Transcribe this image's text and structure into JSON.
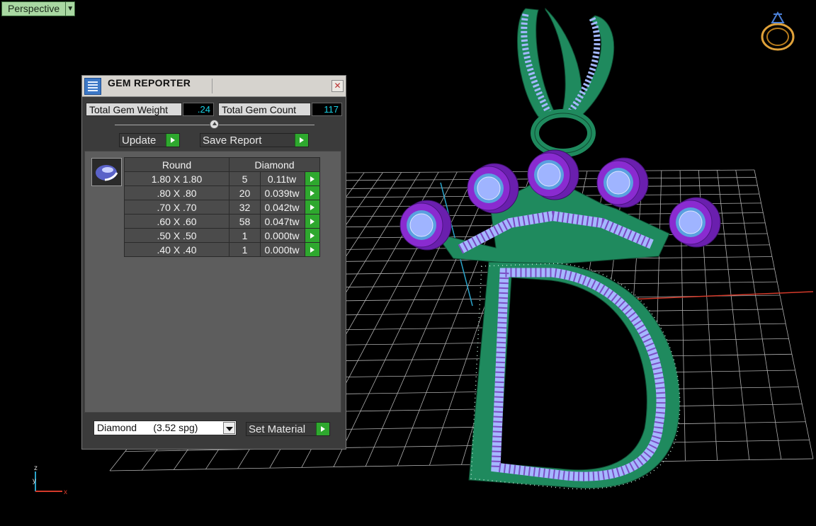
{
  "viewport": {
    "label": "Perspective"
  },
  "gem_reporter": {
    "title": "GEM REPORTER",
    "total_weight_label": "Total Gem Weight",
    "total_weight_value": ".24",
    "total_count_label": "Total Gem Count",
    "total_count_value": "117",
    "update_label": "Update",
    "save_report_label": "Save Report",
    "table": {
      "cut": "Round",
      "material": "Diamond",
      "rows": [
        {
          "size": "1.80 X 1.80",
          "count": "5",
          "weight": "0.11tw"
        },
        {
          "size": ".80 X .80",
          "count": "20",
          "weight": "0.039tw"
        },
        {
          "size": ".70 X .70",
          "count": "32",
          "weight": "0.042tw"
        },
        {
          "size": ".60 X .60",
          "count": "58",
          "weight": "0.047tw"
        },
        {
          "size": ".50 X .50",
          "count": "1",
          "weight": "0.000tw"
        },
        {
          "size": ".40 X .40",
          "count": "1",
          "weight": "0.000tw"
        }
      ]
    },
    "material_select": "Diamond      (3.52 spg)",
    "set_material_label": "Set Material"
  },
  "axes": {
    "z": "z",
    "y": "y",
    "x": "x"
  },
  "colors": {
    "metal": "#1f8a5e",
    "stones": "#9fb4ff",
    "prongs": "#8a2bd0",
    "grid": "#bdbdbd",
    "green_button": "#2ea82e"
  }
}
